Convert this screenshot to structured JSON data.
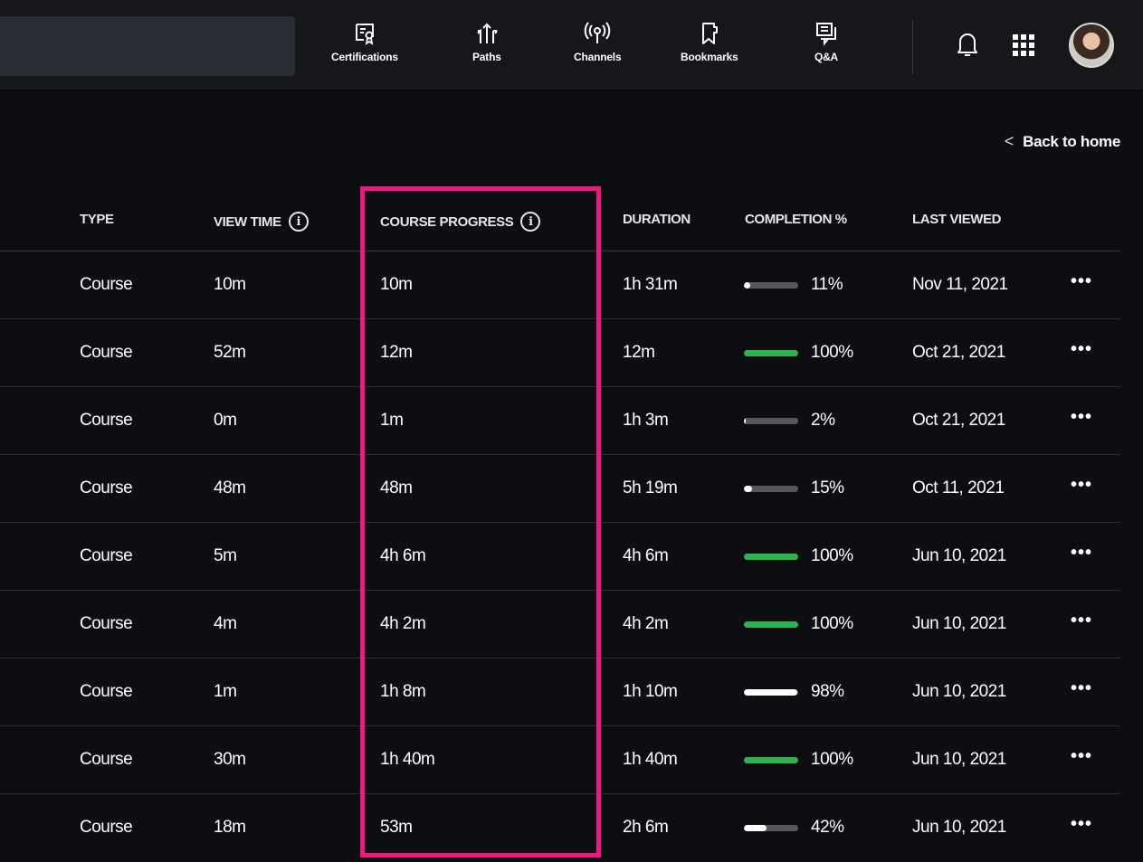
{
  "nav": {
    "items": [
      {
        "label": "Certifications",
        "icon": "certificate-icon"
      },
      {
        "label": "Paths",
        "icon": "paths-icon"
      },
      {
        "label": "Channels",
        "icon": "channels-icon"
      },
      {
        "label": "Bookmarks",
        "icon": "bookmark-icon"
      },
      {
        "label": "Q&A",
        "icon": "qa-icon"
      }
    ],
    "right_icons": [
      "bell-icon",
      "apps-grid-icon",
      "avatar"
    ]
  },
  "back_link": "Back to home",
  "table": {
    "columns": [
      "TYPE",
      "VIEW TIME",
      "COURSE PROGRESS",
      "DURATION",
      "COMPLETION %",
      "LAST VIEWED"
    ],
    "rows": [
      {
        "type": "Course",
        "view_time": "10m",
        "course_progress": "10m",
        "duration": "1h 31m",
        "completion": "11%",
        "completion_value": 11,
        "last_viewed": "Nov 11, 2021"
      },
      {
        "type": "Course",
        "view_time": "52m",
        "course_progress": "12m",
        "duration": "12m",
        "completion": "100%",
        "completion_value": 100,
        "last_viewed": "Oct 21, 2021"
      },
      {
        "type": "Course",
        "view_time": "0m",
        "course_progress": "1m",
        "duration": "1h 3m",
        "completion": "2%",
        "completion_value": 2,
        "last_viewed": "Oct 21, 2021"
      },
      {
        "type": "Course",
        "view_time": "48m",
        "course_progress": "48m",
        "duration": "5h 19m",
        "completion": "15%",
        "completion_value": 15,
        "last_viewed": "Oct 11, 2021"
      },
      {
        "type": "Course",
        "view_time": "5m",
        "course_progress": "4h 6m",
        "duration": "4h 6m",
        "completion": "100%",
        "completion_value": 100,
        "last_viewed": "Jun 10, 2021"
      },
      {
        "type": "Course",
        "view_time": "4m",
        "course_progress": "4h 2m",
        "duration": "4h 2m",
        "completion": "100%",
        "completion_value": 100,
        "last_viewed": "Jun 10, 2021"
      },
      {
        "type": "Course",
        "view_time": "1m",
        "course_progress": "1h 8m",
        "duration": "1h 10m",
        "completion": "98%",
        "completion_value": 98,
        "last_viewed": "Jun 10, 2021"
      },
      {
        "type": "Course",
        "view_time": "30m",
        "course_progress": "1h 40m",
        "duration": "1h 40m",
        "completion": "100%",
        "completion_value": 100,
        "last_viewed": "Jun 10, 2021"
      },
      {
        "type": "Course",
        "view_time": "18m",
        "course_progress": "53m",
        "duration": "2h 6m",
        "completion": "42%",
        "completion_value": 42,
        "last_viewed": "Jun 10, 2021"
      }
    ],
    "row_menu_label": "•••"
  },
  "colors": {
    "complete": "#2ab552",
    "partial": "#ffffff",
    "track": "#55575c",
    "highlight": "#f0187f"
  }
}
